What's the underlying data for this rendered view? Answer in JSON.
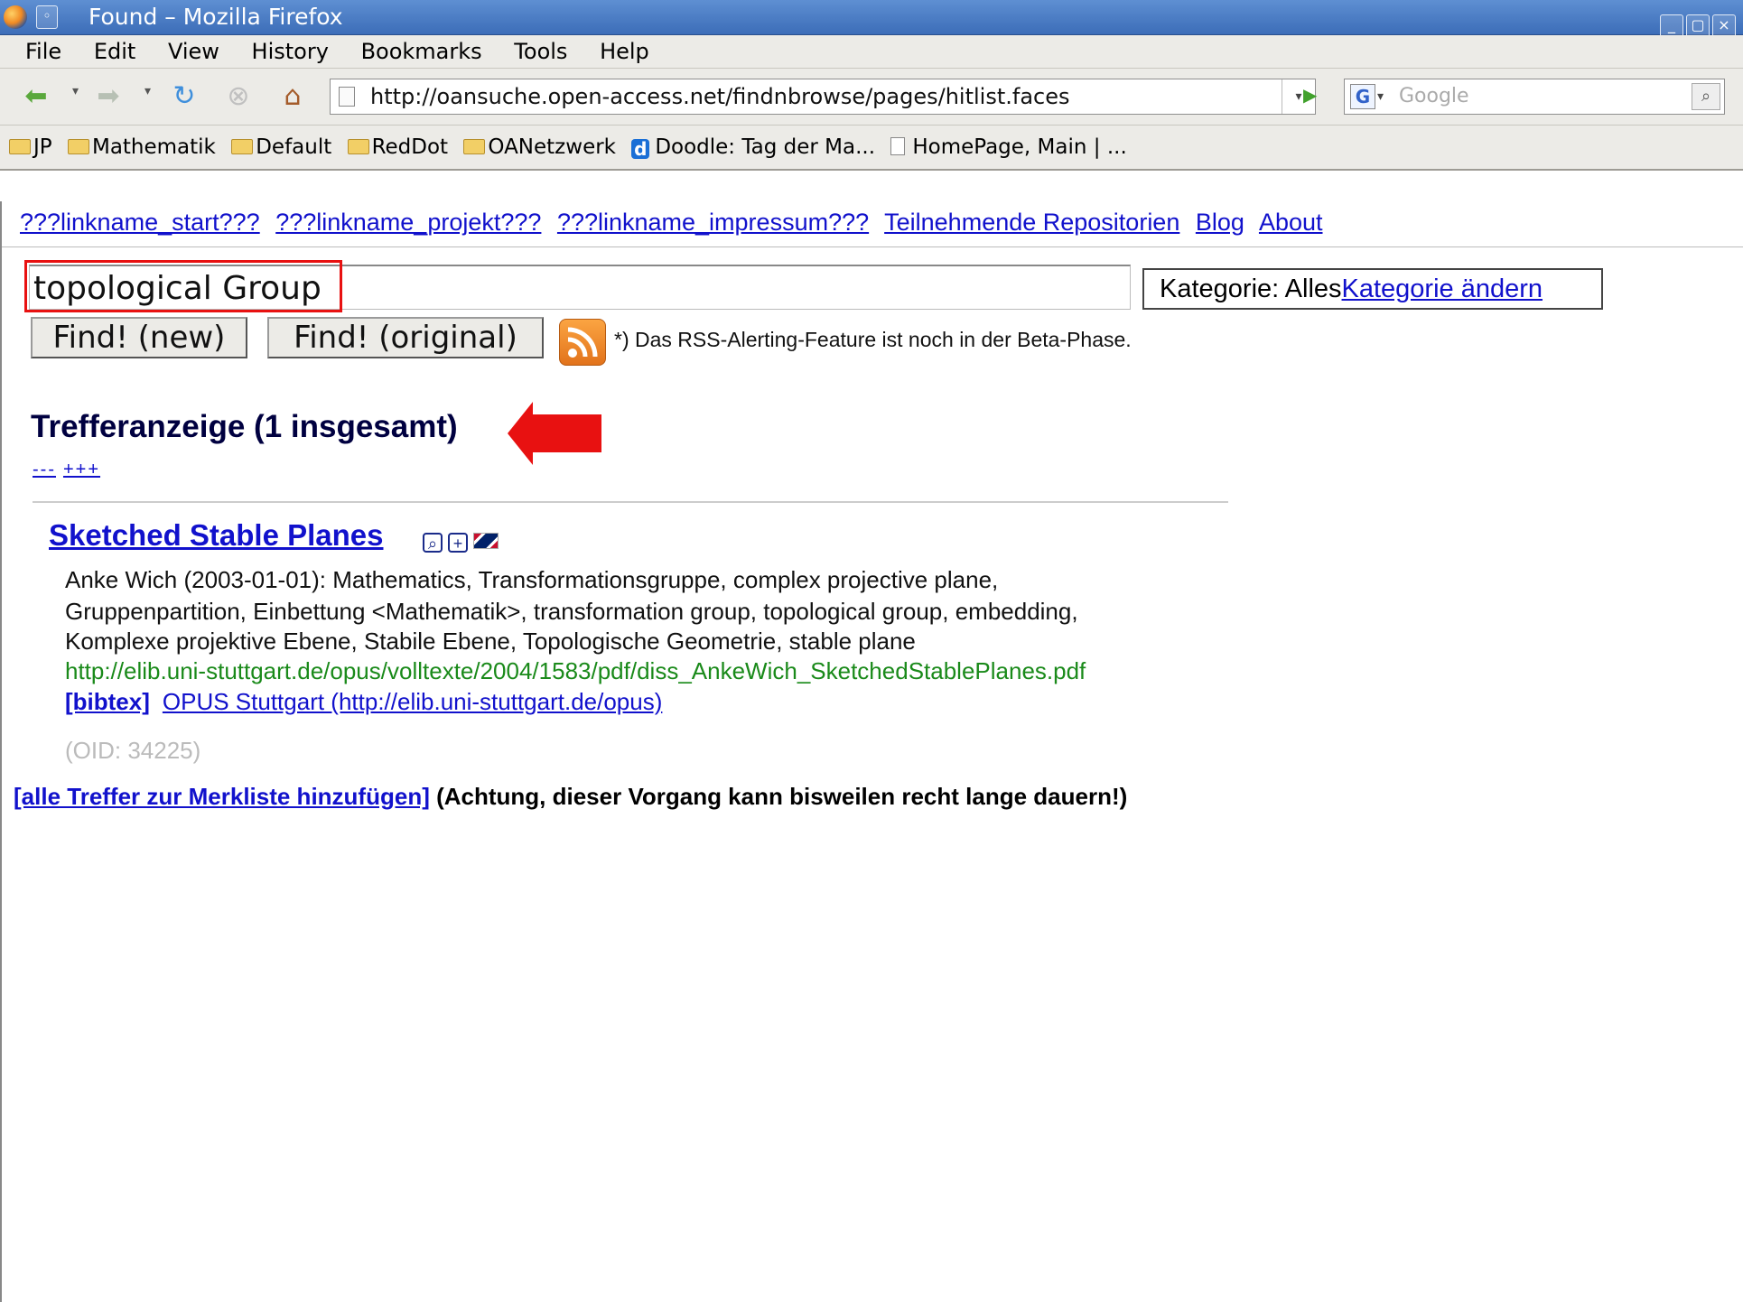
{
  "window": {
    "title": "Found – Mozilla Firefox",
    "buttons": [
      "_",
      "▢",
      "×"
    ]
  },
  "menu": [
    "File",
    "Edit",
    "View",
    "History",
    "Bookmarks",
    "Tools",
    "Help"
  ],
  "navbar": {
    "url": "http://oansuche.open-access.net/findnbrowse/pages/hitlist.faces",
    "search_placeholder": "Google"
  },
  "bookmarks": [
    {
      "label": "JP",
      "icon": "folder-icon"
    },
    {
      "label": "Mathematik",
      "icon": "folder-icon"
    },
    {
      "label": "Default",
      "icon": "folder-icon"
    },
    {
      "label": "RedDot",
      "icon": "folder-icon"
    },
    {
      "label": "OANetzwerk",
      "icon": "folder-icon"
    },
    {
      "label": "Doodle: Tag der Ma...",
      "icon": "doodle-icon"
    },
    {
      "label": "HomePage, Main | ...",
      "icon": "page-icon"
    }
  ],
  "toplinks": [
    "???linkname_start???",
    "???linkname_projekt???",
    "???linkname_impressum???",
    "Teilnehmende Repositorien",
    "Blog",
    "About"
  ],
  "search": {
    "query": "topological Group",
    "category_label": "Kategorie: Alles",
    "category_link": "Kategorie ändern",
    "find_new": "Find! (new)",
    "find_original": "Find! (original)",
    "rss_note": "*) Das RSS-Alerting-Feature ist noch in der Beta-Phase."
  },
  "results": {
    "heading": "Trefferanzeige (1 insgesamt)",
    "pager_minus": "---",
    "pager_plus": "+++",
    "items": [
      {
        "title": "Sketched Stable Planes",
        "line1": "Anke Wich (2003-01-01):  Mathematics, Transformationsgruppe, complex projective plane,",
        "line2": "Gruppenpartition, Einbettung <Mathematik>, transformation group, topological group, embedding,",
        "line3": "Komplexe projektive Ebene, Stabile Ebene, Topologische Geometrie, stable plane",
        "url": "http://elib.uni-stuttgart.de/opus/volltexte/2004/1583/pdf/diss_AnkeWich_SketchedStablePlanes.pdf",
        "bibtex": "[bibtex]",
        "repository": "OPUS Stuttgart (http://elib.uni-stuttgart.de/opus)",
        "oid": "(OID: 34225)"
      }
    ],
    "add_all_link": "[alle Treffer zur Merkliste hinzufügen]",
    "add_all_note": " (Achtung, dieser Vorgang kann bisweilen recht lange dauern!)"
  },
  "colors": {
    "highlight": "#e81111",
    "link": "#1111cc",
    "url_green": "#1a8a1a"
  }
}
